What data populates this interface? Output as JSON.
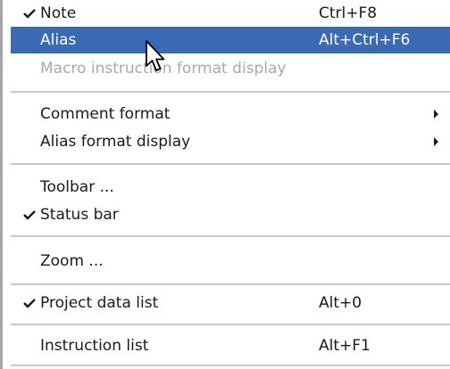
{
  "menu": {
    "items": [
      {
        "label": "Note",
        "shortcut": "Ctrl+F8",
        "checked": true
      },
      {
        "label": "Alias",
        "shortcut": "Alt+Ctrl+F6",
        "selected": true
      },
      {
        "label": "Macro instruction format display",
        "disabled": true
      },
      {
        "label": "Comment format",
        "submenu": true
      },
      {
        "label": "Alias format display",
        "submenu": true
      },
      {
        "label": "Toolbar ..."
      },
      {
        "label": "Status bar",
        "checked": true
      },
      {
        "label": "Zoom ..."
      },
      {
        "label": "Project data list",
        "shortcut": "Alt+0",
        "checked": true
      },
      {
        "label": "Instruction list",
        "shortcut": "Alt+F1"
      }
    ]
  },
  "colors": {
    "highlight": "#3a6ab2",
    "disabled_text": "#a9a9a9",
    "separator": "#c8c8c8"
  },
  "icons": {
    "check": "check-icon",
    "submenu": "submenu-arrow-icon",
    "cursor": "mouse-pointer-icon"
  }
}
